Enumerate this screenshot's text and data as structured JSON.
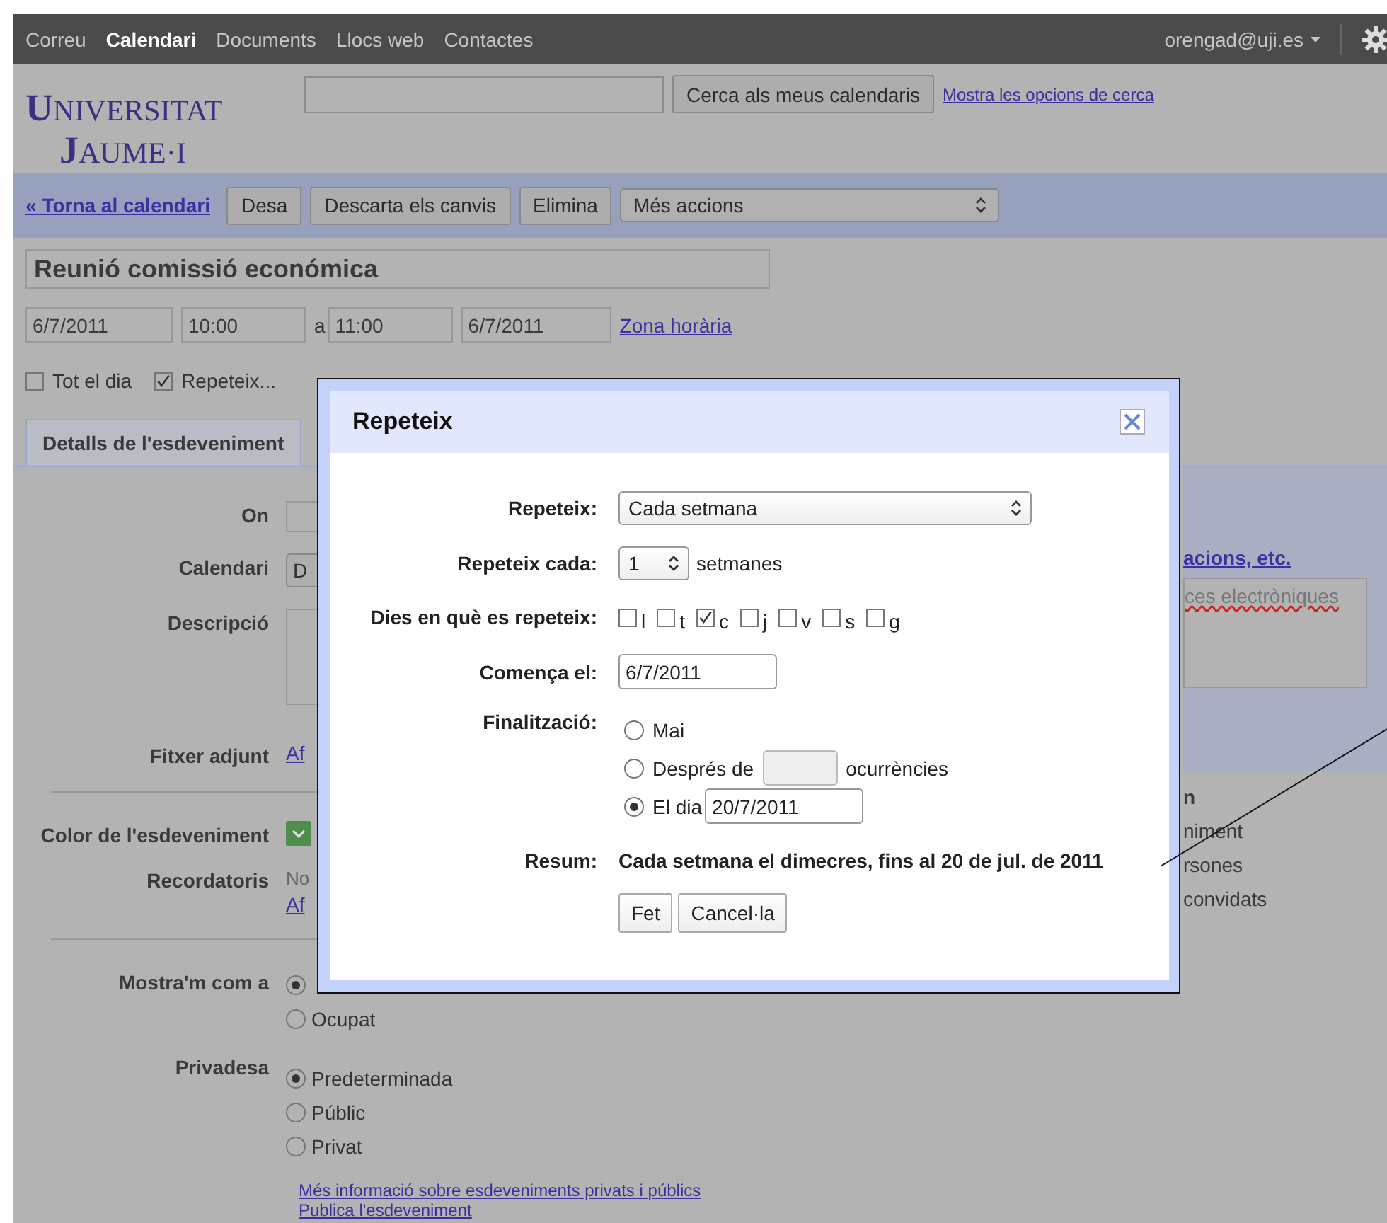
{
  "top_nav": {
    "items": [
      {
        "label": "Correu",
        "selected": false
      },
      {
        "label": "Calendari",
        "selected": true
      },
      {
        "label": "Documents",
        "selected": false
      },
      {
        "label": "Llocs web",
        "selected": false
      },
      {
        "label": "Contactes",
        "selected": false
      }
    ],
    "account": "orengad@uji.es"
  },
  "header": {
    "logo": [
      "UNIVERSITAT",
      "JAUME·I"
    ],
    "search_button": "Cerca als meus calendaris",
    "search_link": "Mostra les opcions de cerca"
  },
  "toolbar": {
    "back_link": "« Torna al calendari",
    "buttons": [
      "Desa",
      "Descarta els canvis",
      "Elimina"
    ],
    "more_actions": "Més accions"
  },
  "event": {
    "title": "Reunió comissió económica",
    "start_date": "6/7/2011",
    "start_time": "10:00",
    "to": "a",
    "end_time": "11:00",
    "end_date": "6/7/2011",
    "timezone_link": "Zona horària",
    "options": [
      {
        "label": "Tot el dia",
        "checked": false
      },
      {
        "label": "Repeteix...",
        "checked": true
      }
    ]
  },
  "tabs": [
    {
      "label": "Detalls de l'esdeveniment",
      "selected": true
    }
  ],
  "details": {
    "rows": [
      {
        "kind": "input",
        "label": "On"
      },
      {
        "kind": "select",
        "label": "Calendari",
        "value": "D"
      },
      {
        "kind": "textarea",
        "label": "Descripció"
      },
      {
        "kind": "link",
        "label": "Fitxer adjunt",
        "link": "Af"
      },
      {
        "kind": "divider"
      },
      {
        "kind": "color",
        "label": "Color de l'esdeveniment"
      },
      {
        "kind": "reminder",
        "label": "Recordatoris",
        "text": "No",
        "link": "Af"
      },
      {
        "kind": "divider"
      },
      {
        "kind": "radios",
        "label": "Mostra'm com a",
        "options": [
          {
            "selected": true
          },
          {
            "label": "Ocupat",
            "selected": false
          }
        ]
      },
      {
        "kind": "radios",
        "label": "Privadesa",
        "options": [
          {
            "label": "Predeterminada",
            "selected": true
          },
          {
            "label": "Públic",
            "selected": false
          },
          {
            "label": "Privat",
            "selected": false
          }
        ]
      }
    ],
    "links": [
      "Més informació sobre esdeveniments privats i públics",
      "Publica l'esdeveniment"
    ]
  },
  "side_panel": {
    "link": "acions, etc.",
    "textarea_text": "ces electròniques",
    "heading": "n",
    "items": [
      "niment",
      "rsones",
      "convidats"
    ]
  },
  "dialog": {
    "title": "Repeteix",
    "repeat_label": "Repeteix:",
    "repeat_value": "Cada setmana",
    "every_label": "Repeteix cada:",
    "every_value": "1",
    "every_unit": "setmanes",
    "days_label": "Dies en què es repeteix:",
    "days": [
      {
        "label": "l",
        "checked": false
      },
      {
        "label": "t",
        "checked": false
      },
      {
        "label": "c",
        "checked": true
      },
      {
        "label": "j",
        "checked": false
      },
      {
        "label": "v",
        "checked": false
      },
      {
        "label": "s",
        "checked": false
      },
      {
        "label": "g",
        "checked": false
      }
    ],
    "start_label": "Comença el:",
    "start_value": "6/7/2011",
    "end_label": "Finalització:",
    "end_options": [
      {
        "kind": "never",
        "label": "Mai",
        "selected": false
      },
      {
        "kind": "after",
        "label": "Després de",
        "suffix": "ocurrències",
        "selected": false
      },
      {
        "kind": "on",
        "label": "El dia",
        "value": "20/7/2011",
        "selected": true
      }
    ],
    "summary_label": "Resum:",
    "summary": "Cada setmana el dimecres, fins al 20 de jul. de 2011",
    "buttons": [
      "Fet",
      "Cancel·la"
    ]
  }
}
